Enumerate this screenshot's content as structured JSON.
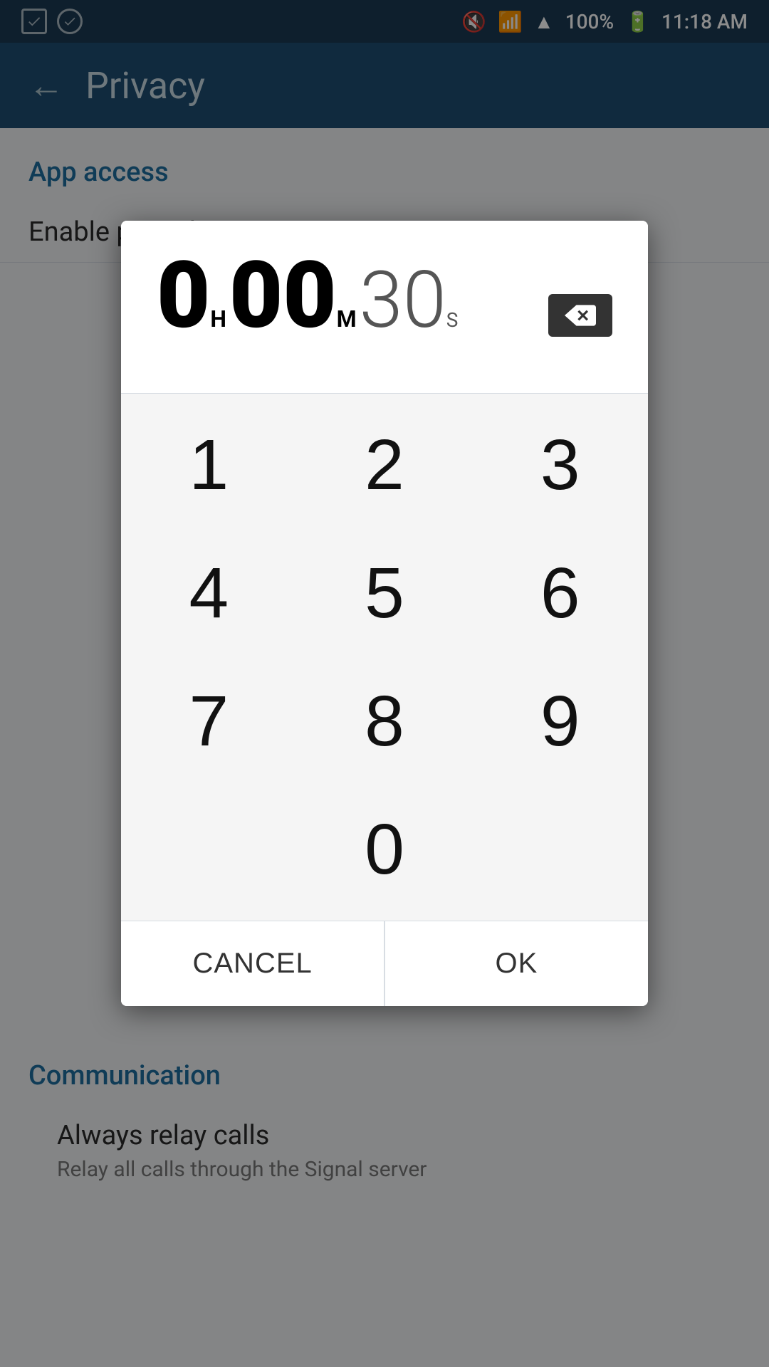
{
  "statusBar": {
    "time": "11:18 AM",
    "battery": "100%",
    "icons": [
      "notification-icon",
      "wifi-icon",
      "signal-icon",
      "battery-icon"
    ]
  },
  "appBar": {
    "title": "Privacy",
    "backLabel": "←"
  },
  "background": {
    "appAccessLabel": "App access",
    "enablePassphraseLabel": "Enable passphrase",
    "communicationLabel": "Communication",
    "alwaysRelayCallsLabel": "Always relay calls",
    "alwaysRelayCallsDesc": "Relay all calls through the Signal server"
  },
  "dialog": {
    "hours": "0",
    "hoursLabel": "H",
    "minutes": "00",
    "minutesLabel": "M",
    "seconds": "30",
    "secondsLabel": "S",
    "numpad": [
      [
        "1",
        "2",
        "3"
      ],
      [
        "4",
        "5",
        "6"
      ],
      [
        "7",
        "8",
        "9"
      ],
      [
        "0"
      ]
    ],
    "cancelLabel": "CANCEL",
    "okLabel": "OK"
  }
}
